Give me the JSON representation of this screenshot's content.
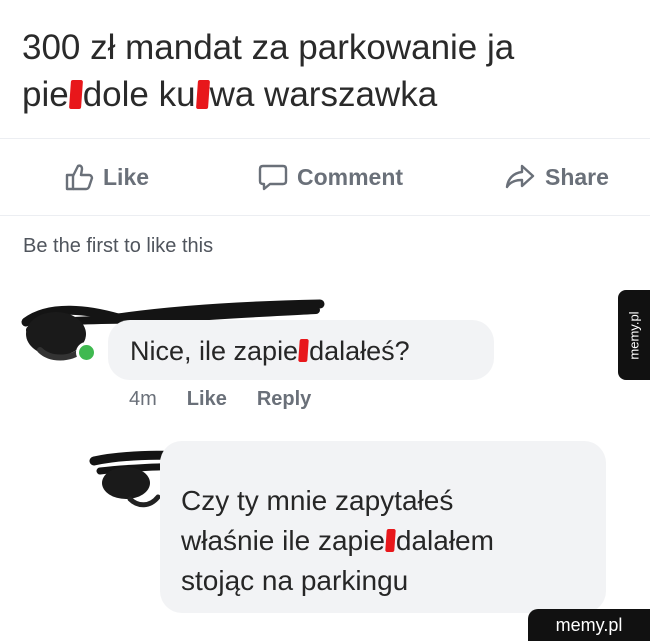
{
  "post": {
    "line1": "300 zł mandat za parkowanie ja",
    "line2_a": "pie",
    "line2_b": "dole ku",
    "line2_c": "wa warszawka"
  },
  "actions": {
    "like": "Like",
    "comment": "Comment",
    "share": "Share"
  },
  "likes_summary": "Be the first to like this",
  "comment1": {
    "text_a": "Nice, ile zapie",
    "text_b": "dalałeś?",
    "time": "4m",
    "like": "Like",
    "reply": "Reply"
  },
  "comment2": {
    "line1": "Czy ty mnie zapytałeś",
    "line2_a": "właśnie ile zapie",
    "line2_b": "dalałem",
    "line3": "stojąc na parkingu"
  },
  "watermark": {
    "side": "memy.pl",
    "corner": "memy.pl"
  },
  "colors": {
    "censor": "#e8171b",
    "bubble": "#f2f3f5",
    "online": "#3fb950",
    "action_text": "#6a7079"
  },
  "icons": [
    "thumbs-up-icon",
    "comment-icon",
    "share-icon"
  ]
}
